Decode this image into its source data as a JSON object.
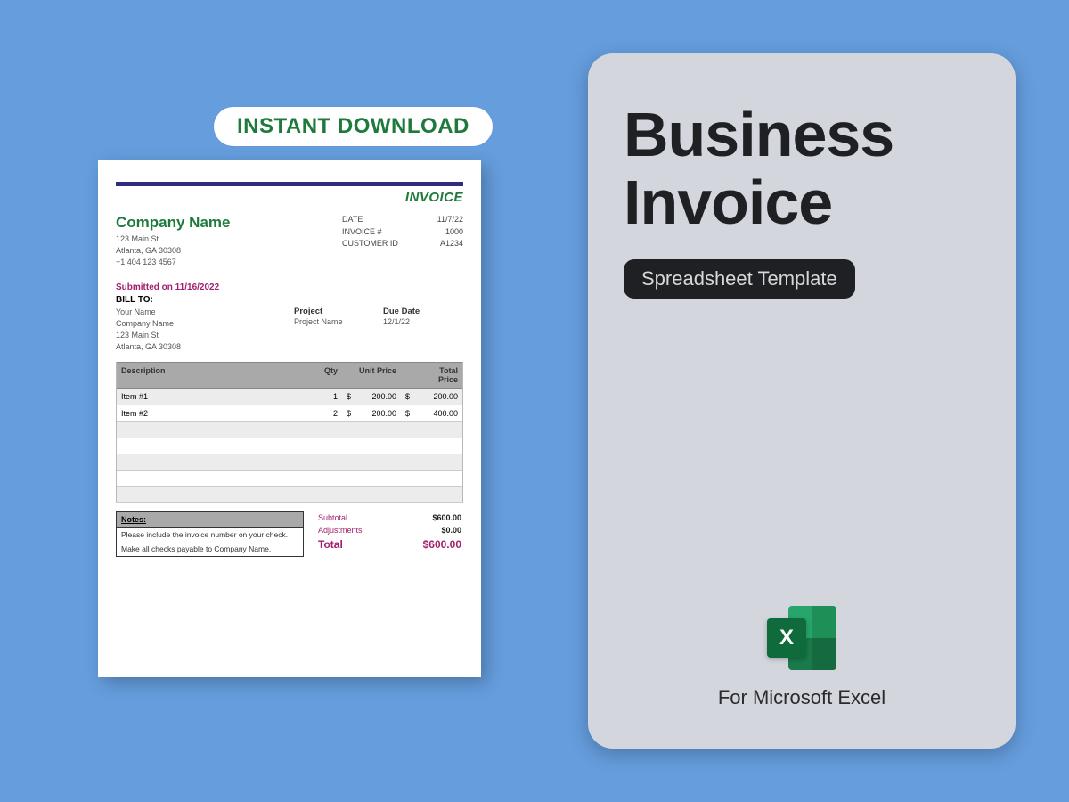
{
  "badge": {
    "label": "INSTANT DOWNLOAD"
  },
  "invoice": {
    "title": "INVOICE",
    "company": {
      "name": "Company Name",
      "addr1": "123 Main St",
      "addr2": "Atlanta, GA 30308",
      "phone": "+1 404 123 4567"
    },
    "meta": {
      "date_label": "DATE",
      "date_value": "11/7/22",
      "inv_label": "INVOICE #",
      "inv_value": "1000",
      "cust_label": "CUSTOMER ID",
      "cust_value": "A1234"
    },
    "submitted": "Submitted on 11/16/2022",
    "billto_label": "BILL TO:",
    "billto": {
      "name": "Your Name",
      "company": "Company Name",
      "addr1": "123 Main St",
      "addr2": "Atlanta, GA 30308"
    },
    "project": {
      "label": "Project",
      "value": "Project Name"
    },
    "due": {
      "label": "Due Date",
      "value": "12/1/22"
    },
    "columns": {
      "desc": "Description",
      "qty": "Qty",
      "unit": "Unit Price",
      "total": "Total Price"
    },
    "items": [
      {
        "desc": "Item #1",
        "qty": "1",
        "cur": "$",
        "unit": "200.00",
        "cur2": "$",
        "total": "200.00"
      },
      {
        "desc": "Item #2",
        "qty": "2",
        "cur": "$",
        "unit": "200.00",
        "cur2": "$",
        "total": "400.00"
      }
    ],
    "notes": {
      "label": "Notes:",
      "line1": "Please include the invoice number on your check.",
      "line2": "Make all checks  payable to Company Name."
    },
    "totals": {
      "subtotal_label": "Subtotal",
      "subtotal": "$600.00",
      "adj_label": "Adjustments",
      "adj": "$0.00",
      "total_label": "Total",
      "total": "$600.00"
    }
  },
  "panel": {
    "title1": "Business",
    "title2": "Invoice",
    "chip": "Spreadsheet Template",
    "excel_letter": "X",
    "for_text": "For Microsoft Excel"
  }
}
